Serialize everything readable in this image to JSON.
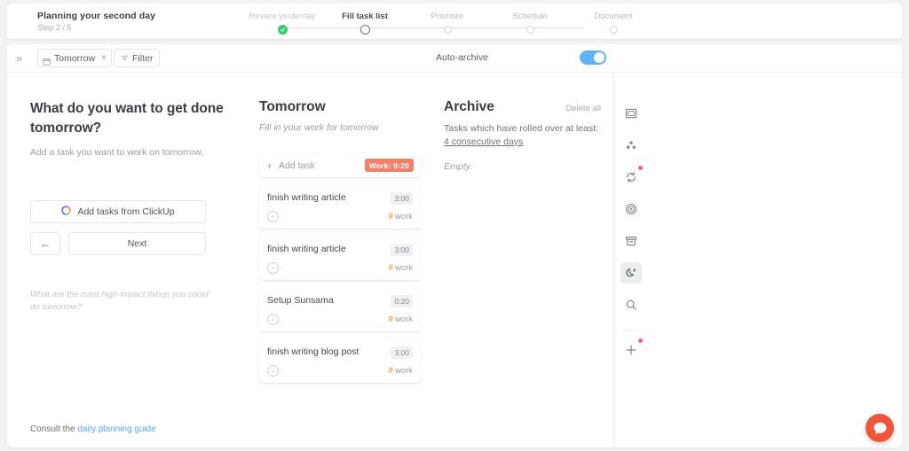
{
  "wizard": {
    "title": "Planning your second day",
    "step_label": "Step 2 / 5",
    "steps": [
      {
        "label": "Review yesterday",
        "state": "done"
      },
      {
        "label": "Fill task list",
        "state": "current"
      },
      {
        "label": "Prioritize",
        "state": "todo"
      },
      {
        "label": "Schedule",
        "state": "todo"
      },
      {
        "label": "Document",
        "state": "todo"
      }
    ]
  },
  "toolbar": {
    "expand_icon": "chevron-double-right-icon",
    "date_chip": {
      "label": "Tomorrow",
      "icon": "calendar-icon",
      "close": "×"
    },
    "filter_label": "Filter",
    "auto_archive_label": "Auto-archive",
    "auto_archive_on": true,
    "toggle_color": "#5eb3f6"
  },
  "left_panel": {
    "question": "What do you want to get done tomorrow?",
    "subtitle": "Add a task you want to work on tomorrow.",
    "clickup_button": "Add tasks from ClickUp",
    "back_label": "←",
    "next_label": "Next",
    "hint": "What are the most high-impact things you could do tomorrow?",
    "footer_prefix": "Consult the",
    "footer_link": "daily planning guide"
  },
  "tomorrow": {
    "title": "Tomorrow",
    "subtitle": "Fill in your work for tomorrow",
    "add_task_label": "Add task",
    "work_badge": "Work: 9:20",
    "work_badge_color": "#ef8268",
    "tasks": [
      {
        "title": "finish writing article",
        "duration": "3:00",
        "channel": "work"
      },
      {
        "title": "finish writing article",
        "duration": "3:00",
        "channel": "work"
      },
      {
        "title": "Setup Sunsama",
        "duration": "0:20",
        "channel": "work"
      },
      {
        "title": "finish writing blog post",
        "duration": "3:00",
        "channel": "work"
      }
    ]
  },
  "archive": {
    "title": "Archive",
    "delete_all": "Delete all",
    "description": "Tasks which have rolled over at least:",
    "threshold_link": "4 consecutive days",
    "empty": "Empty."
  },
  "rail": {
    "items": [
      {
        "name": "calendar-day-icon",
        "badge": false,
        "active": false
      },
      {
        "name": "team-icon",
        "badge": false,
        "active": false
      },
      {
        "name": "sync-icon",
        "badge": true,
        "active": false
      },
      {
        "name": "target-icon",
        "badge": false,
        "active": false
      },
      {
        "name": "archive-box-icon",
        "badge": false,
        "active": false
      },
      {
        "name": "moon-sparkle-icon",
        "badge": false,
        "active": true
      },
      {
        "name": "search-icon",
        "badge": false,
        "active": false
      },
      {
        "name": "plus-icon",
        "badge": true,
        "active": false
      }
    ],
    "badge_color": "#f4589b"
  },
  "intercom": {
    "name": "chat-bubble-icon",
    "color": "#f0563c"
  }
}
